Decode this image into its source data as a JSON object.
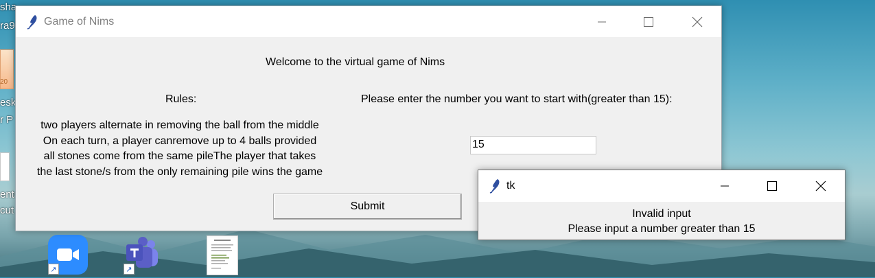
{
  "desktop": {
    "fragments": [
      "sha",
      "ra9",
      "20",
      "esk",
      "r P",
      "ents",
      "cut"
    ],
    "taskbar_icons": [
      "zoom-icon",
      "teams-icon",
      "document-thumbnail-icon"
    ]
  },
  "main_window": {
    "title": "Game of Nims",
    "welcome": "Welcome to the virtual game of Nims",
    "rules_heading": "Rules:",
    "rules_lines": [
      "two players alternate in removing the ball from the middle",
      "On each turn, a player canremove up to 4 balls provided",
      "all stones come from the same pileThe player that takes",
      "the last stone/s from the only remaining pile wins the game"
    ],
    "prompt": "Please enter the number you want to start with(greater than 15):",
    "entry_value": "15",
    "submit_label": "Submit",
    "controls": {
      "minimize": "minimize-icon",
      "maximize": "maximize-icon",
      "close": "close-icon"
    }
  },
  "popup_window": {
    "title": "tk",
    "message_line1": "Invalid input",
    "message_line2": "Please input a number greater than 15"
  },
  "colors": {
    "window_bg": "#f0f0f0",
    "titlebar_bg": "#ffffff",
    "inactive_title_text": "#808080",
    "zoom_blue": "#2d8cff",
    "teams_purple": "#5b5fc7"
  }
}
